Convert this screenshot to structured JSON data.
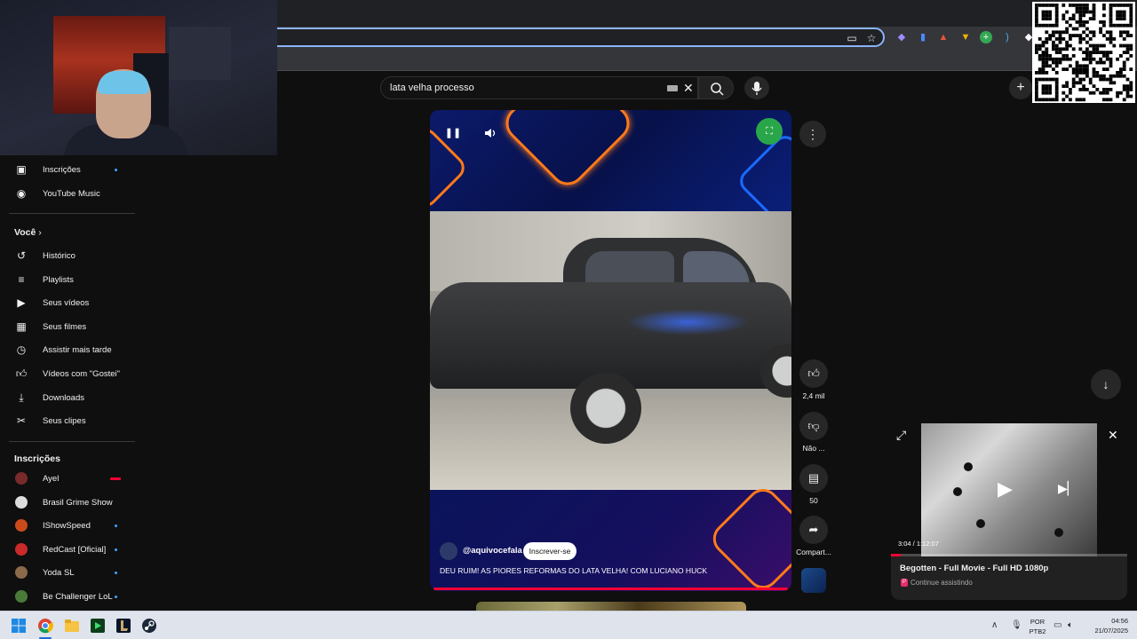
{
  "search": {
    "query": "lata velha processo"
  },
  "sidebar": {
    "items_top": [
      {
        "label": "Inscrições",
        "icon": "subscriptions-icon",
        "dot": true
      },
      {
        "label": "YouTube Music",
        "icon": "youtube-music-icon",
        "dot": false
      }
    ],
    "you_heading": "Você",
    "items_you": [
      {
        "label": "Histórico",
        "icon": "history-icon"
      },
      {
        "label": "Playlists",
        "icon": "playlists-icon"
      },
      {
        "label": "Seus vídeos",
        "icon": "your-videos-icon"
      },
      {
        "label": "Seus filmes",
        "icon": "your-movies-icon"
      },
      {
        "label": "Assistir mais tarde",
        "icon": "watch-later-icon"
      },
      {
        "label": "Vídeos com \"Gostei\"",
        "icon": "liked-videos-icon"
      },
      {
        "label": "Downloads",
        "icon": "download-icon"
      },
      {
        "label": "Seus clipes",
        "icon": "clips-icon"
      }
    ],
    "subs_heading": "Inscrições",
    "subscriptions": [
      {
        "label": "Ayel",
        "color": "#7a2a2a",
        "status": "live"
      },
      {
        "label": "Brasil Grime Show",
        "color": "#dddddd",
        "status": "none"
      },
      {
        "label": "IShowSpeed",
        "color": "#c94a1a",
        "status": "dot"
      },
      {
        "label": "RedCast [Oficial]",
        "color": "#c92a2a",
        "status": "dot"
      },
      {
        "label": "Yoda SL",
        "color": "#8a6a4a",
        "status": "dot"
      },
      {
        "label": "Be Challenger LoL",
        "color": "#4a7a3a",
        "status": "dot"
      }
    ]
  },
  "short": {
    "channel": "@aquivocefala",
    "subscribe_label": "Inscrever-se",
    "title": "DEU RUIM! AS PIORES REFORMAS DO LATA VELHA! COM LUCIANO HUCK",
    "like_count": "2,4 mil",
    "dislike_label": "Não ...",
    "comment_count": "50",
    "share_label": "Compart..."
  },
  "miniplayer": {
    "time": "3:04 / 1:12:07",
    "title": "Begotten - Full Movie - Full HD 1080p",
    "subtitle": "Continue assistindo",
    "progress": 0.042
  },
  "taskbar": {
    "lang_top": "POR",
    "lang_bottom": "PTB2",
    "time": "04:56",
    "date": "21/07/2025"
  },
  "colors": {
    "accent_red": "#ff0033",
    "link_blue": "#3ea6ff",
    "focus_ring": "#8ab4f8"
  }
}
